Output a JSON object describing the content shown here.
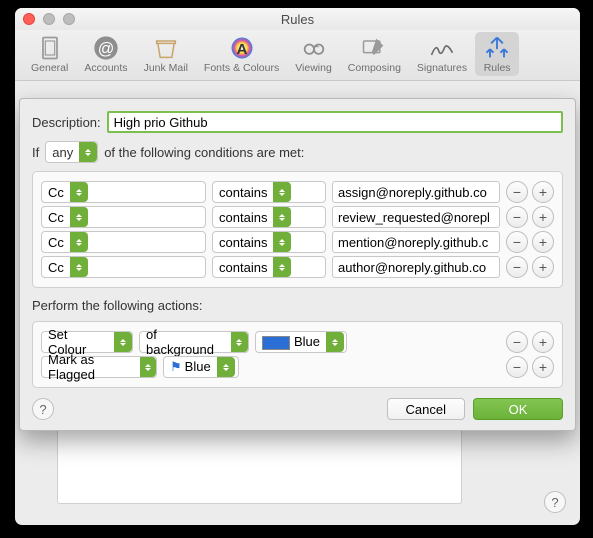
{
  "window": {
    "title": "Rules"
  },
  "toolbar": {
    "items": [
      {
        "label": "General"
      },
      {
        "label": "Accounts"
      },
      {
        "label": "Junk Mail"
      },
      {
        "label": "Fonts & Colours"
      },
      {
        "label": "Viewing"
      },
      {
        "label": "Composing"
      },
      {
        "label": "Signatures"
      },
      {
        "label": "Rules"
      }
    ]
  },
  "sheet": {
    "description_label": "Description:",
    "description_value": "High prio Github",
    "if_label": "If",
    "match_mode": "any",
    "if_suffix": "of the following conditions are met:",
    "conditions": [
      {
        "field": "Cc",
        "op": "contains",
        "value": "assign@noreply.github.co"
      },
      {
        "field": "Cc",
        "op": "contains",
        "value": "review_requested@norepl"
      },
      {
        "field": "Cc",
        "op": "contains",
        "value": "mention@noreply.github.c"
      },
      {
        "field": "Cc",
        "op": "contains",
        "value": "author@noreply.github.co"
      }
    ],
    "actions_label": "Perform the following actions:",
    "actions": [
      {
        "type": "Set Colour",
        "target": "of background",
        "value": "Blue"
      },
      {
        "type": "Mark as Flagged",
        "value": "Blue"
      }
    ],
    "buttons": {
      "cancel": "Cancel",
      "ok": "OK"
    },
    "help": "?"
  }
}
